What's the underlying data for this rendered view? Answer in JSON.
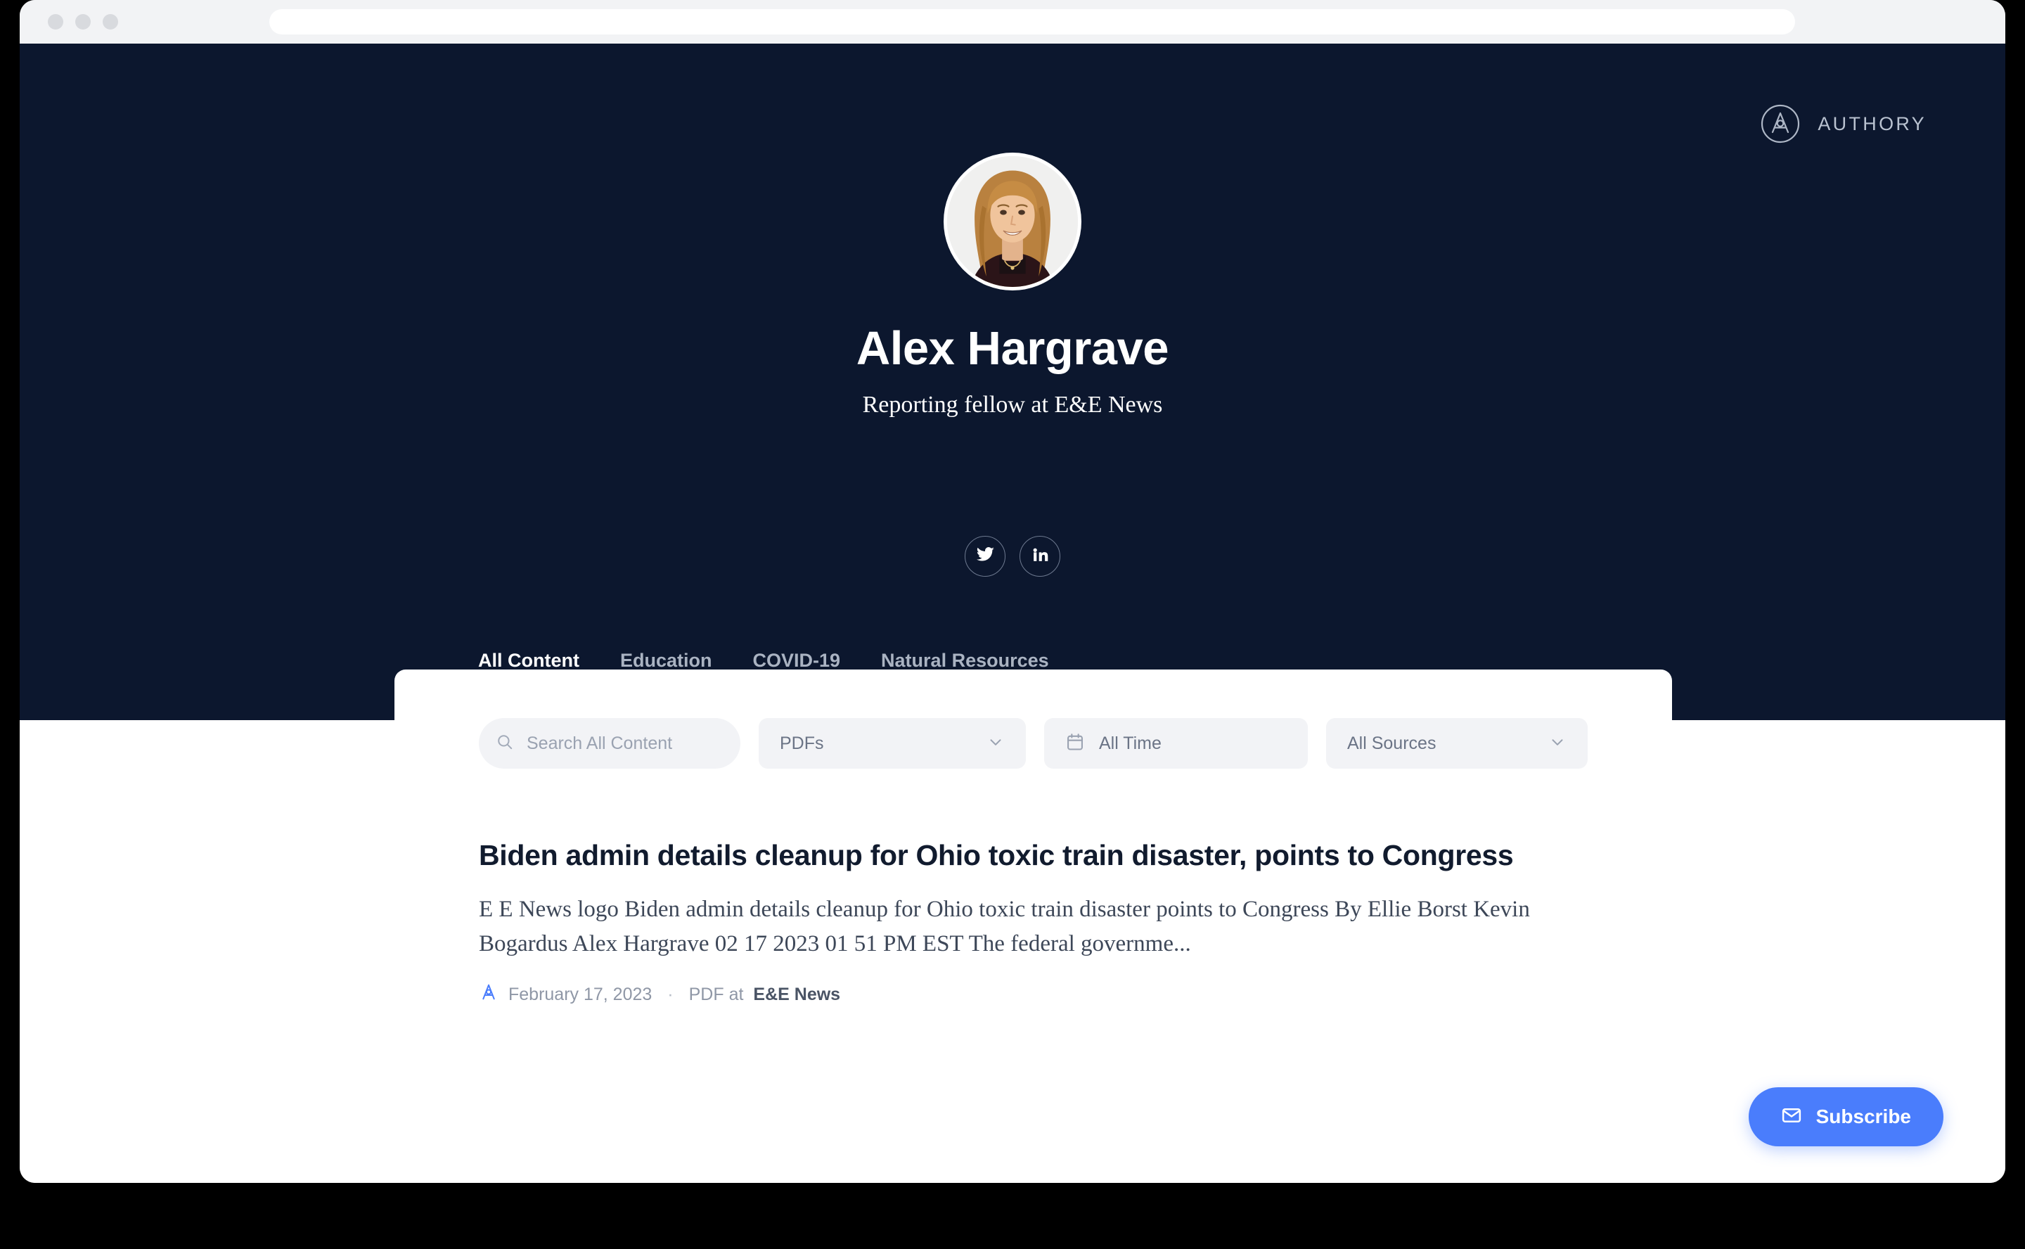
{
  "browser": {
    "address_bar_value": "",
    "address_bar_placeholder": ""
  },
  "brand": {
    "name": "AUTHORY",
    "logo_icon": "authory-a-circle-icon"
  },
  "profile": {
    "name": "Alex Hargrave",
    "tagline": "Reporting fellow at E&E News",
    "avatar_alt": "Alex Hargrave portrait",
    "social": [
      {
        "network": "twitter",
        "icon": "twitter-icon"
      },
      {
        "network": "linkedin",
        "icon": "linkedin-icon"
      }
    ]
  },
  "tabs": [
    {
      "label": "All Content",
      "active": true
    },
    {
      "label": "Education",
      "active": false
    },
    {
      "label": "COVID-19",
      "active": false
    },
    {
      "label": "Natural Resources",
      "active": false
    }
  ],
  "filters": {
    "search": {
      "value": "",
      "placeholder": "Search All Content",
      "icon": "search-icon"
    },
    "type": {
      "value": "PDFs",
      "icon": "chevron-down-icon"
    },
    "time": {
      "value": "All Time",
      "icon": "calendar-icon"
    },
    "sources": {
      "value": "All Sources",
      "icon": "chevron-down-icon"
    }
  },
  "articles": [
    {
      "title": "Biden admin details cleanup for Ohio toxic train disaster, points to Congress",
      "excerpt": "E E News logo Biden admin details cleanup for Ohio toxic train disaster points to Congress By Ellie Borst Kevin Bogardus Alex Hargrave 02 17 2023 01 51 PM EST The federal governme...",
      "date": "February 17, 2023",
      "separator": "·",
      "format_and_source": "PDF at ",
      "source": "E&E News",
      "badge_icon": "authory-a-icon"
    }
  ],
  "subscribe": {
    "label": "Subscribe",
    "icon": "mail-icon"
  },
  "colors": {
    "hero_navy": "#0c172e",
    "accent_blue": "#4a7dfc",
    "card_white": "#ffffff",
    "chip_gray": "#f2f3f6",
    "page_black": "#000000"
  }
}
